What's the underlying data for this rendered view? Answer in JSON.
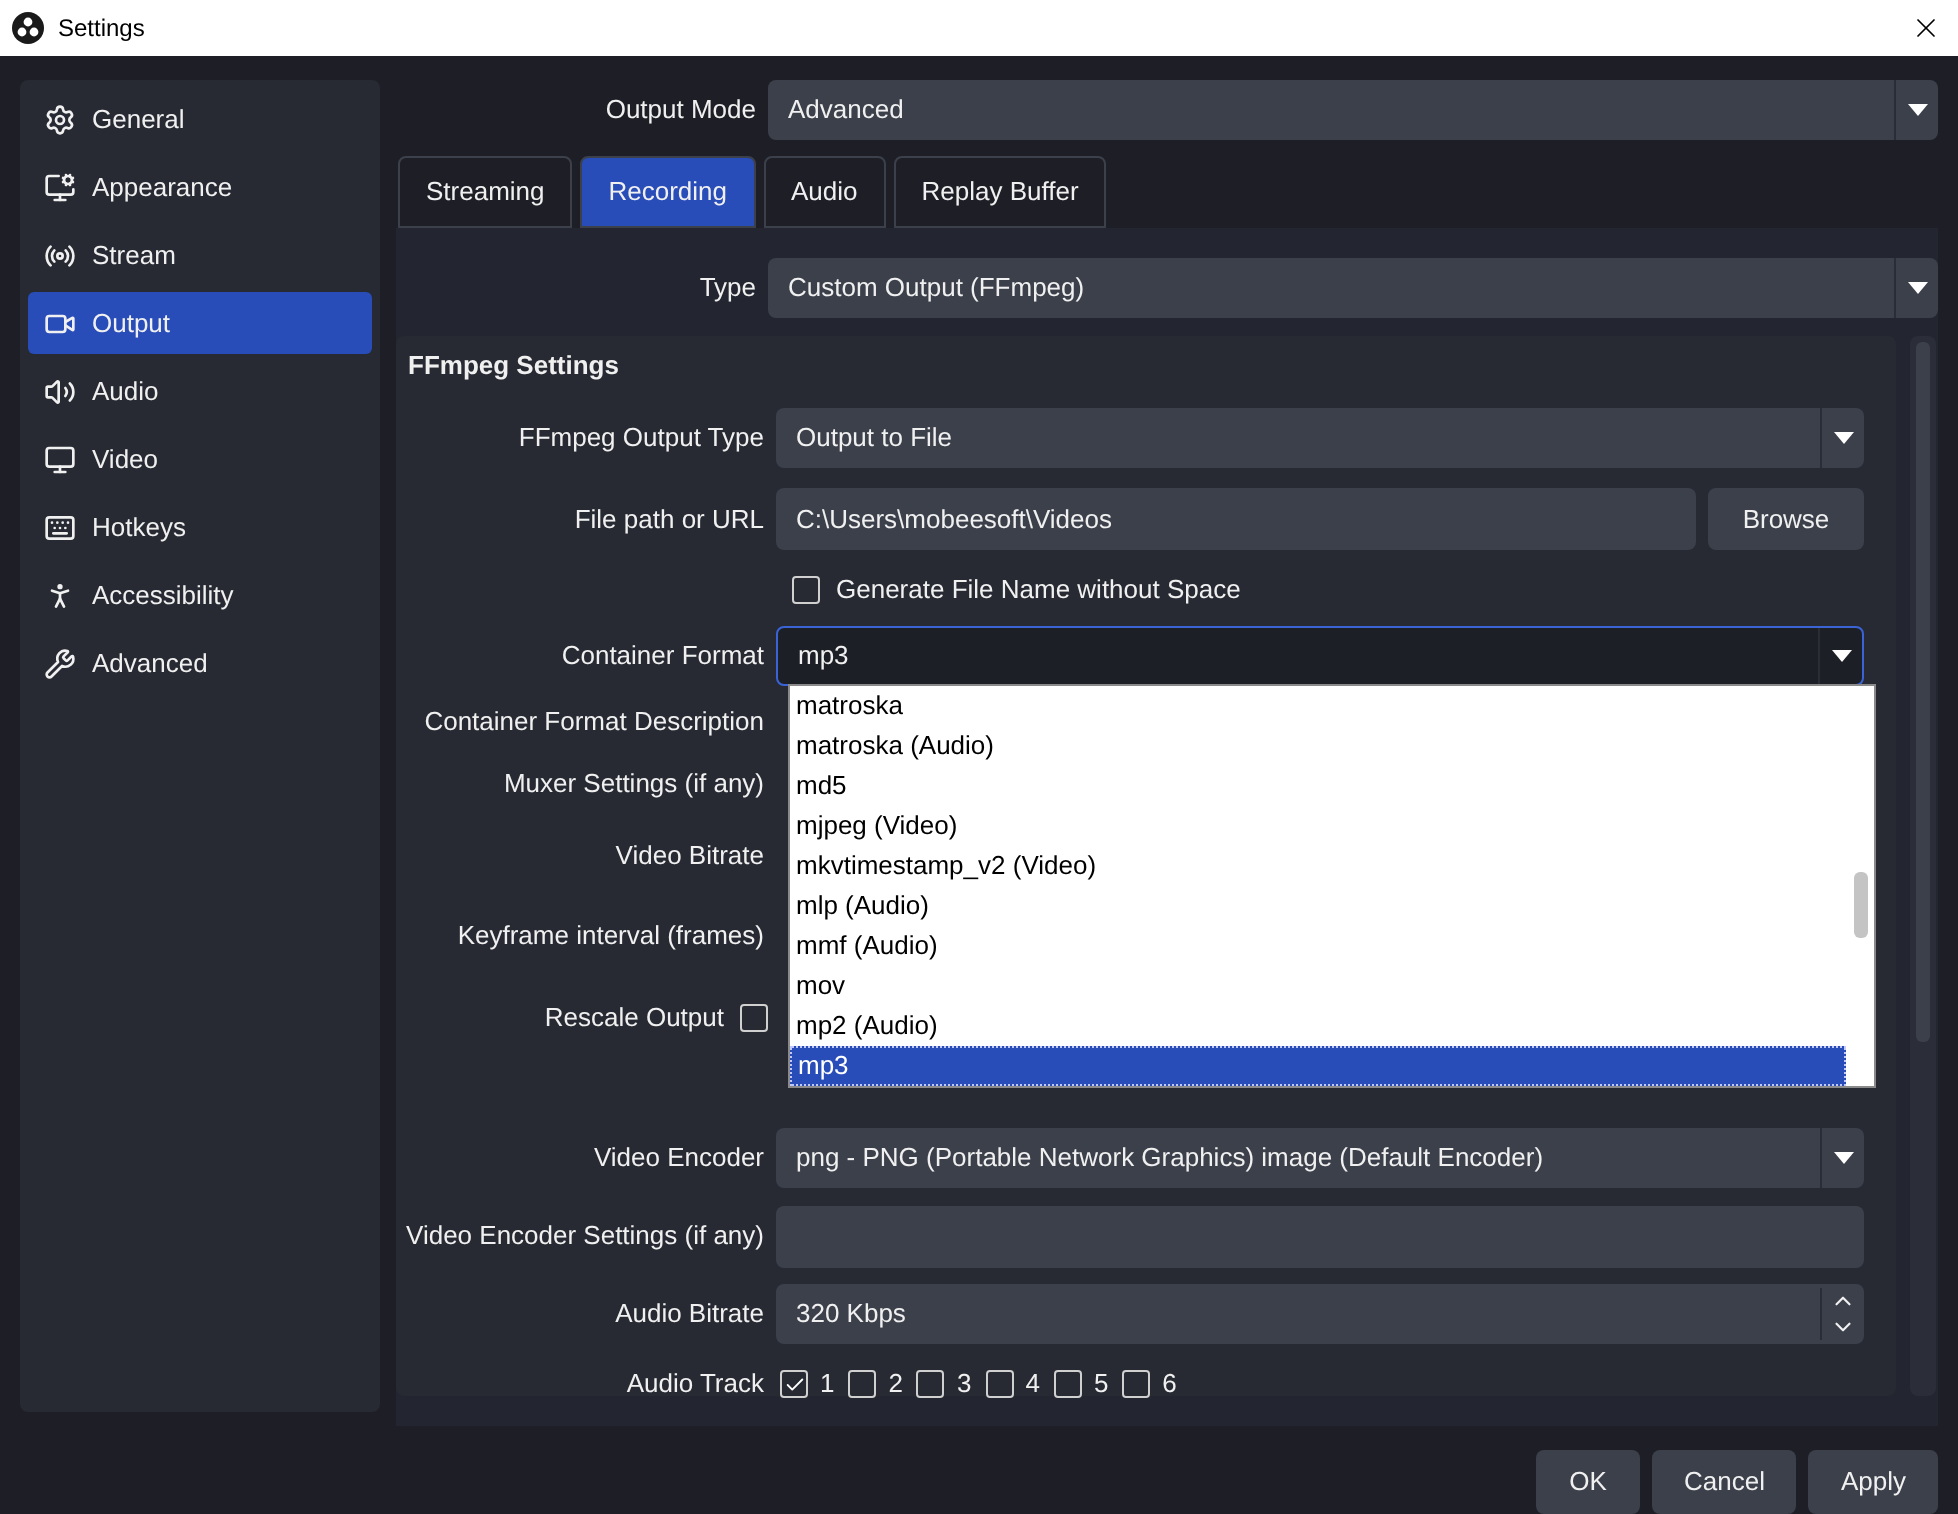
{
  "window": {
    "title": "Settings"
  },
  "sidebar": {
    "items": [
      {
        "label": "General",
        "selected": false
      },
      {
        "label": "Appearance",
        "selected": false
      },
      {
        "label": "Stream",
        "selected": false
      },
      {
        "label": "Output",
        "selected": true
      },
      {
        "label": "Audio",
        "selected": false
      },
      {
        "label": "Video",
        "selected": false
      },
      {
        "label": "Hotkeys",
        "selected": false
      },
      {
        "label": "Accessibility",
        "selected": false
      },
      {
        "label": "Advanced",
        "selected": false
      }
    ]
  },
  "output_mode": {
    "label": "Output Mode",
    "value": "Advanced"
  },
  "tabs": [
    {
      "label": "Streaming",
      "selected": false
    },
    {
      "label": "Recording",
      "selected": true
    },
    {
      "label": "Audio",
      "selected": false
    },
    {
      "label": "Replay Buffer",
      "selected": false
    }
  ],
  "type": {
    "label": "Type",
    "value": "Custom Output (FFmpeg)"
  },
  "group": {
    "title": "FFmpeg Settings",
    "rows": [
      {
        "kind": "combo",
        "label": "FFmpeg Output Type",
        "value": "Output to File"
      },
      {
        "kind": "path",
        "label": "File path or URL",
        "value": "C:\\Users\\mobeesoft\\Videos",
        "button": "Browse"
      },
      {
        "kind": "checkbox",
        "text": "Generate File Name without Space",
        "checked": false
      },
      {
        "kind": "combo",
        "label": "Container Format",
        "value": "mp3",
        "focused": true
      },
      {
        "kind": "label",
        "label": "Container Format Description"
      },
      {
        "kind": "label",
        "label": "Muxer Settings (if any)"
      },
      {
        "kind": "label",
        "label": "Video Bitrate"
      },
      {
        "kind": "label",
        "label": "Keyframe interval (frames)"
      },
      {
        "kind": "label_check",
        "label": "Rescale Output",
        "checked": false
      },
      {
        "kind": "combo",
        "label": "Video Encoder",
        "value": "png - PNG (Portable Network Graphics) image (Default Encoder)"
      },
      {
        "kind": "field",
        "label": "Video Encoder Settings (if any)"
      },
      {
        "kind": "spin",
        "label": "Audio Bitrate",
        "value": "320 Kbps"
      },
      {
        "kind": "tracks",
        "label": "Audio Track",
        "tracks": [
          {
            "label": "1",
            "checked": true
          },
          {
            "label": "2",
            "checked": false
          },
          {
            "label": "3",
            "checked": false
          },
          {
            "label": "4",
            "checked": false
          },
          {
            "label": "5",
            "checked": false
          },
          {
            "label": "6",
            "checked": false
          }
        ]
      }
    ]
  },
  "dropdown": {
    "items": [
      {
        "label": "matroska",
        "selected": false
      },
      {
        "label": "matroska (Audio)",
        "selected": false
      },
      {
        "label": "md5",
        "selected": false
      },
      {
        "label": "mjpeg (Video)",
        "selected": false
      },
      {
        "label": "mkvtimestamp_v2 (Video)",
        "selected": false
      },
      {
        "label": "mlp (Audio)",
        "selected": false
      },
      {
        "label": "mmf (Audio)",
        "selected": false
      },
      {
        "label": "mov",
        "selected": false
      },
      {
        "label": "mp2 (Audio)",
        "selected": false
      },
      {
        "label": "mp3",
        "selected": true
      }
    ]
  },
  "buttons": [
    "OK",
    "Cancel",
    "Apply"
  ]
}
